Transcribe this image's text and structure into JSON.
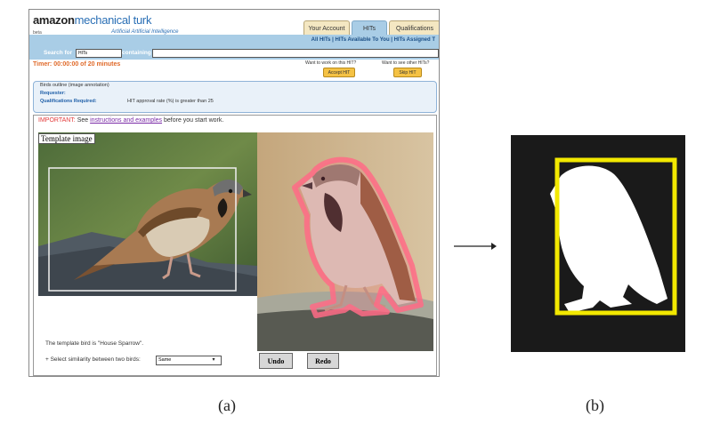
{
  "figure": {
    "label_a": "(a)",
    "label_b": "(b)"
  },
  "mturk": {
    "logo_amazon": "amazon",
    "logo_mturk": "mechanical turk",
    "tagline": "Artificial Artificial Intelligence",
    "beta": "beta",
    "tabs": [
      "Your Account",
      "HITs",
      "Qualifications"
    ],
    "active_tab": "HITs",
    "subnav": "All HITs  |  HITs Available To You  |  HITs Assigned T",
    "search_label": "Search for",
    "search_select": "HITs",
    "containing_label": "containing",
    "timer": "Timer: 00:00:00 of 20 minutes",
    "work_prompt": "Want to work on this HIT?",
    "other_prompt": "Want to see other HITs?",
    "accept_button": "Accept HIT",
    "skip_button": "Skip HIT",
    "hit_title": "Birds outline (image annotation)",
    "requester_label": "Requester:",
    "qual_label": "Qualifications Required:",
    "qual_value": "HIT approval rate (%) is greater than 25",
    "important_prefix": "IMPORTANT:",
    "important_see": " See ",
    "important_link": "instructions and examples",
    "important_suffix": " before you start work.",
    "template_label": "Template image",
    "caption_template": "The template bird is \"House Sparrow\".",
    "similarity_label": "+ Select similarity between two birds:",
    "similarity_value": "Same",
    "undo_button": "Undo",
    "redo_button": "Redo"
  },
  "colors": {
    "mturk_blue": "#a9cde6",
    "timer_orange": "#e06a2a",
    "accept_yellow": "#f5c244",
    "outline_pink": "#ff6b86",
    "box_yellow": "#f2e800"
  }
}
